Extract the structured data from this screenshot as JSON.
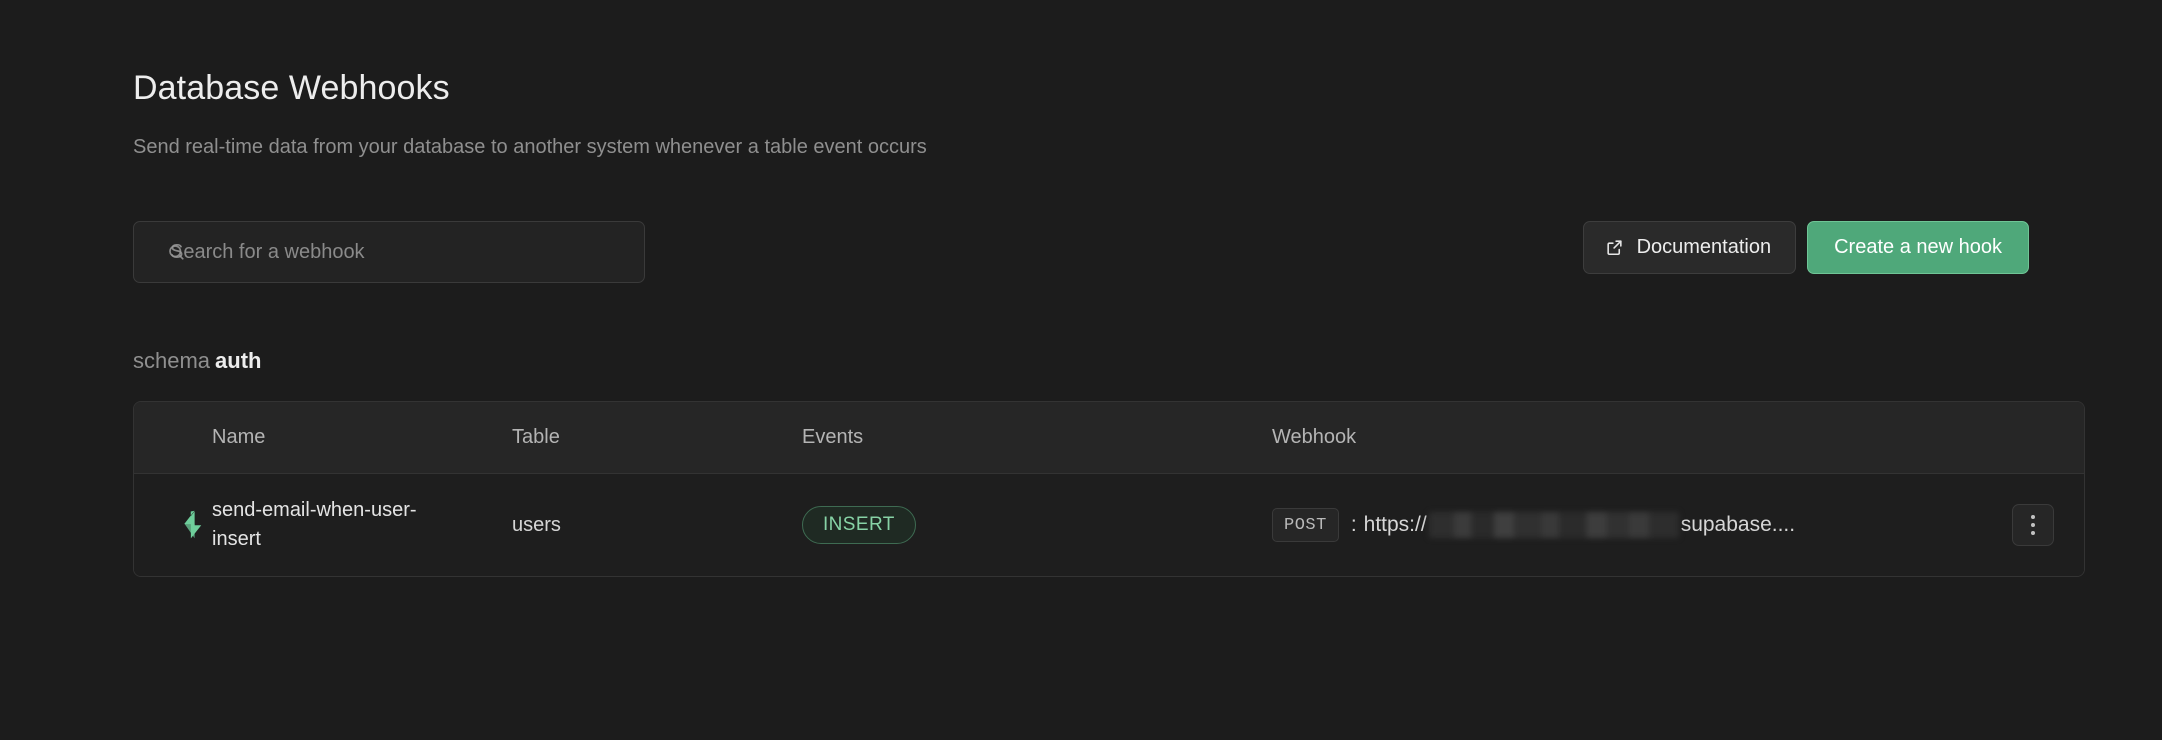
{
  "header": {
    "title": "Database Webhooks",
    "subtitle": "Send real-time data from your database to another system whenever a table event occurs"
  },
  "toolbar": {
    "search_placeholder": "Search for a webhook",
    "search_value": "",
    "search_icon": "search-icon",
    "documentation_label": "Documentation",
    "documentation_icon": "external-link-icon",
    "create_label": "Create a new hook"
  },
  "schema": {
    "label": "schema",
    "name": "auth"
  },
  "table": {
    "columns": [
      "Name",
      "Table",
      "Events",
      "Webhook"
    ],
    "rows": [
      {
        "icon": "lightning-bolt-icon",
        "name": "send-email-when-user-insert",
        "table": "users",
        "events": [
          "INSERT"
        ],
        "webhook": {
          "method": "POST",
          "separator": ":",
          "url_prefix": "https://",
          "url_redacted": true,
          "url_suffix": "supabase...."
        },
        "menu_icon": "more-vertical-icon"
      }
    ]
  },
  "colors": {
    "background": "#1c1c1c",
    "accent_green": "#4fa87a",
    "badge_green_text": "#87d3a6",
    "badge_green_border": "#3e6b52",
    "bolt_green": "#6ece9b",
    "text_primary": "#ededed",
    "text_muted": "#8f8f8f",
    "border": "#333333"
  }
}
